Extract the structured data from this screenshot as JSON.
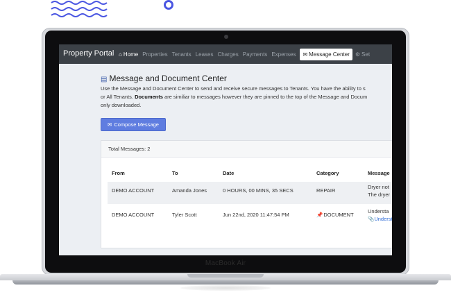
{
  "device": {
    "label": "MacBook Air"
  },
  "app": {
    "brand": "Property Portal",
    "nav": [
      {
        "label": "Home",
        "icon": "home-icon"
      },
      {
        "label": "Properties"
      },
      {
        "label": "Tenants"
      },
      {
        "label": "Leases"
      },
      {
        "label": "Charges"
      },
      {
        "label": "Payments"
      },
      {
        "label": "Expenses"
      },
      {
        "label": "Message Center",
        "icon": "envelope-icon"
      },
      {
        "label": "Set",
        "icon": "gears-icon"
      }
    ],
    "page": {
      "title": "Message and Document Center",
      "desc_1": "Use the Message and Document Center to send and receive secure messages to Tenants. You have the ability to s",
      "desc_2a": "or All Tenants. ",
      "desc_2b": "Documents",
      "desc_2c": " are similiar to messages however they are pinned to the top of the Message and Docum",
      "desc_3": "only downloaded.",
      "compose_label": "Compose Message"
    },
    "messages": {
      "total_label": "Total Messages: 2",
      "columns": [
        "From",
        "To",
        "Date",
        "Category",
        "Message"
      ],
      "rows": [
        {
          "from": "DEMO ACCOUNT",
          "to": "Amanda Jones",
          "date": "0 HOURS, 00 MINS, 35 SECS",
          "category": "REPAIR",
          "msg1": "Dryer not",
          "msg2": "The dryer"
        },
        {
          "from": "DEMO ACCOUNT",
          "to": "Tyler Scott",
          "date": "Jun 22nd, 2020 11:47:54 PM",
          "category": "DOCUMENT",
          "msg1": "Understa",
          "msg2": "Underst"
        }
      ]
    }
  },
  "colors": {
    "nav_bg": "#3c4147",
    "accent": "#5f7de0",
    "link": "#2e6bd6",
    "decor": "#4a56e2"
  }
}
